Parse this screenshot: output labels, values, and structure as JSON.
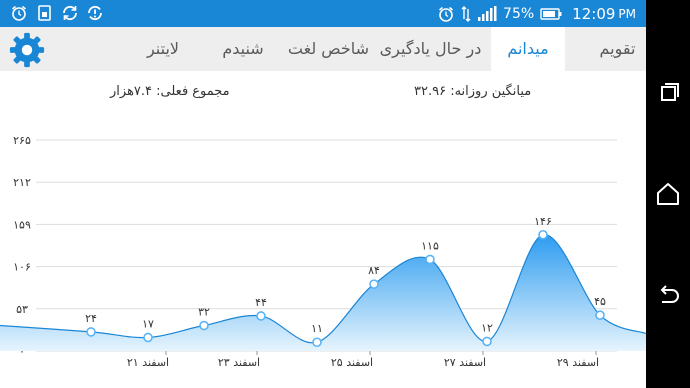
{
  "status_bar": {
    "icons_left": [
      "alarm-icon",
      "sim-icon",
      "sync-icon",
      "sync-problem-icon"
    ],
    "icons_right": [
      "alarm-icon",
      "data-arrows-icon",
      "signal-icon",
      "battery-icon"
    ],
    "battery": "75%",
    "time": "12:09",
    "ampm": "PM"
  },
  "tabs": [
    {
      "label": "تقویم",
      "active": false
    },
    {
      "label": "میدانم",
      "active": true
    },
    {
      "label": "در حال یادگیری",
      "active": false
    },
    {
      "label": "شاخص لغت",
      "active": false
    },
    {
      "label": "شنیدم",
      "active": false
    },
    {
      "label": "لایتنر",
      "active": false
    }
  ],
  "settings_icon": "gear-icon",
  "stats": {
    "daily_average": "میانگین روزانه: ۳۲.۹۶",
    "current_total": "مجموع فعلی: ۷.۴هزار"
  },
  "colors": {
    "accent": "#1a86d6",
    "status_bar": "#1a86d6",
    "tab_bar": "#eeeeee",
    "fill_top": "#2d9cf0",
    "fill_bottom": "#e6f4fd"
  },
  "chart_data": {
    "type": "area",
    "y_ticks": [
      0,
      53,
      106,
      159,
      212,
      265
    ],
    "y_tick_labels": [
      "۰",
      "۵۳",
      "۱۰۶",
      "۱۵۹",
      "۲۱۲",
      "۲۶۵"
    ],
    "ylim": [
      0,
      265
    ],
    "x_tick_labels": [
      "۲۱ اسفند",
      "۲۳ اسفند",
      "۲۵ اسفند",
      "۲۷ اسفند",
      "۲۹ اسفند"
    ],
    "points": [
      {
        "value": 24,
        "label": "۲۴"
      },
      {
        "value": 17,
        "label": "۱۷"
      },
      {
        "value": 32,
        "label": "۳۲"
      },
      {
        "value": 44,
        "label": "۴۴"
      },
      {
        "value": 11,
        "label": "۱۱"
      },
      {
        "value": 84,
        "label": "۸۴"
      },
      {
        "value": 115,
        "label": "۱۱۵"
      },
      {
        "value": 12,
        "label": "۱۲"
      },
      {
        "value": 146,
        "label": "۱۴۶"
      },
      {
        "value": 45,
        "label": "۴۵"
      }
    ],
    "grid": true
  },
  "nav_bar": {
    "icons": [
      "recent-apps-icon",
      "home-icon",
      "back-icon"
    ]
  }
}
